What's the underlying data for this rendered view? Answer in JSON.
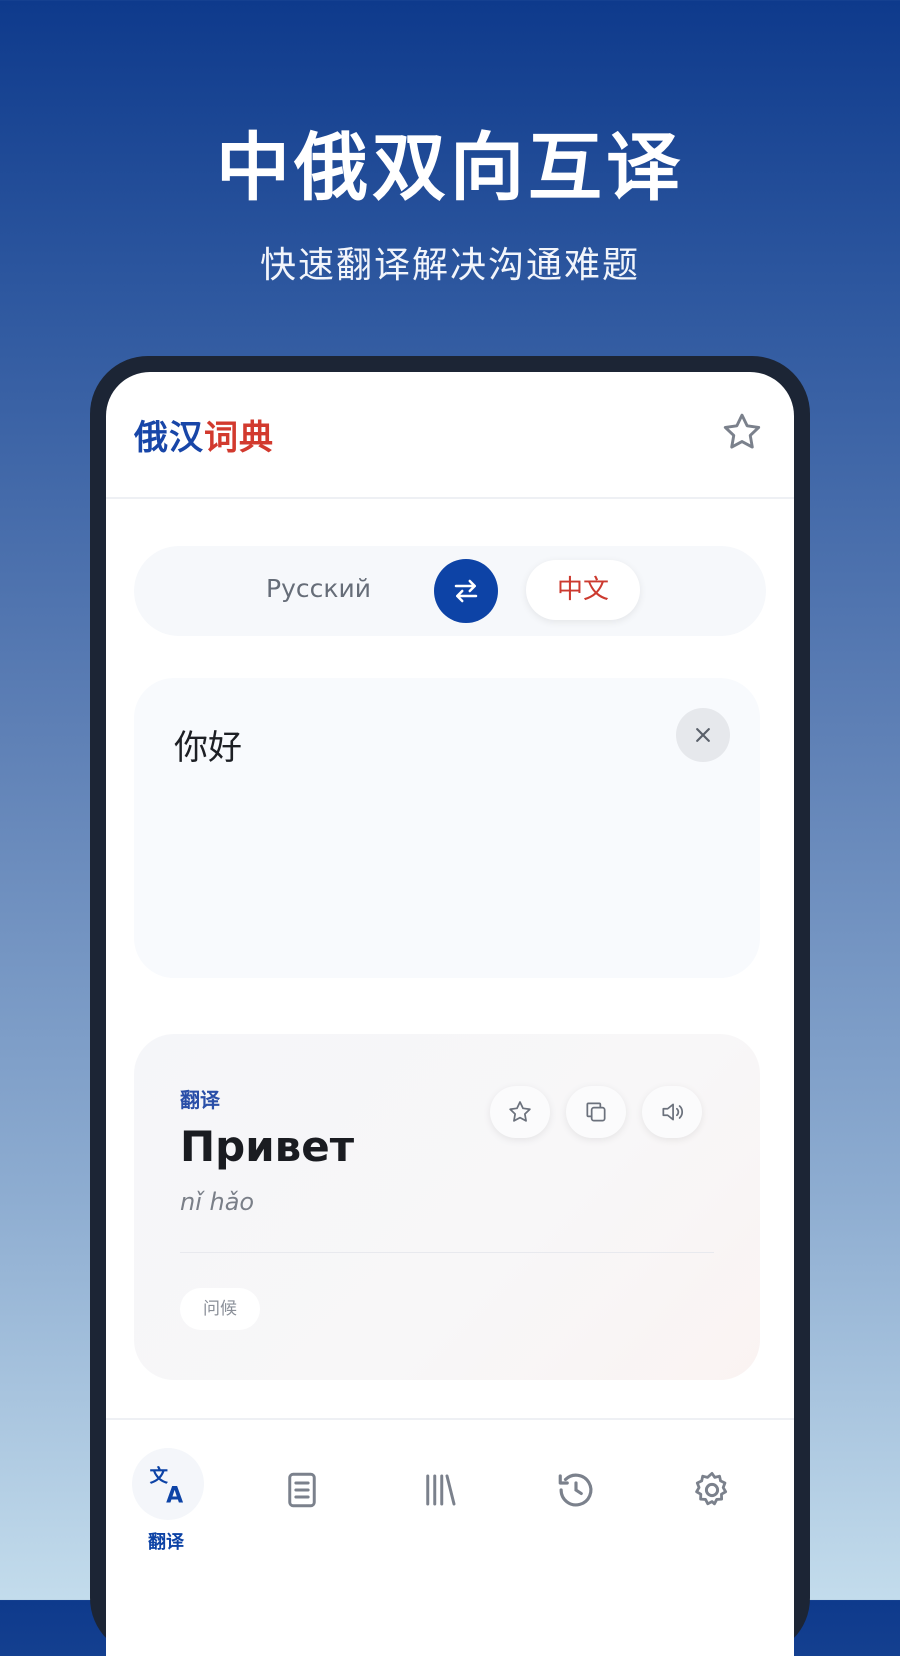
{
  "hero": {
    "title": "中俄双向互译",
    "subtitle": "快速翻译解决沟通难题"
  },
  "app": {
    "logo_part1": "俄汉",
    "logo_part2": "词典",
    "header_icon": "star-icon"
  },
  "language_bar": {
    "source": "Русский",
    "target": "中文",
    "swap_icon": "swap-arrows-icon"
  },
  "input": {
    "value": "你好",
    "clear_icon": "close-icon"
  },
  "result": {
    "label": "翻译",
    "word": "Привет",
    "pinyin": "nǐ hǎo",
    "tag": "问候",
    "actions": [
      "star-icon",
      "copy-icon",
      "speaker-icon"
    ]
  },
  "nav": {
    "items": [
      {
        "icon": "translate-icon",
        "label": "翻译",
        "active": true
      },
      {
        "icon": "book-icon",
        "active": false
      },
      {
        "icon": "library-icon",
        "active": false
      },
      {
        "icon": "history-icon",
        "active": false
      },
      {
        "icon": "gear-icon",
        "active": false
      }
    ]
  },
  "colors": {
    "primary": "#0d43a6",
    "accent_red": "#d23a2e"
  }
}
